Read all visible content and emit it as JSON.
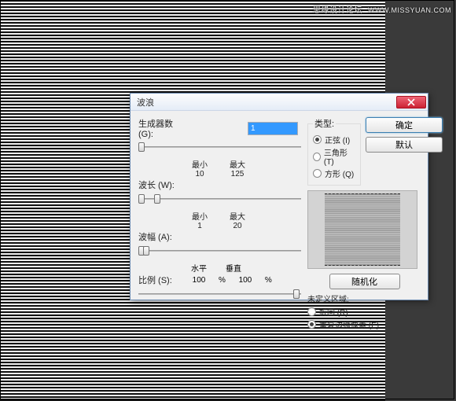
{
  "watermark": {
    "cn": "思缘设计论坛",
    "en": "WWW.MISSYUAN.COM"
  },
  "dialog": {
    "title": "波浪",
    "generators": {
      "label": "生成器数 (G):",
      "value": "1"
    },
    "wavelength": {
      "label": "波长 (W):",
      "min_label": "最小",
      "max_label": "最大",
      "min": "10",
      "max": "125"
    },
    "amplitude": {
      "label": "波幅 (A):",
      "min_label": "最小",
      "max_label": "最大",
      "min": "1",
      "max": "20"
    },
    "scale": {
      "label": "比例 (S):",
      "h_label": "水平",
      "v_label": "垂直",
      "h": "100",
      "v": "100",
      "unit": "%"
    },
    "type": {
      "legend": "类型:",
      "sine": "正弦 (I)",
      "triangle": "三角形 (T)",
      "square": "方形 (Q)",
      "selected": "sine"
    },
    "buttons": {
      "ok": "确定",
      "default": "默认",
      "randomize": "随机化"
    },
    "undefined_area": {
      "legend": "未定义区域:",
      "wrap": "折回 (R)",
      "repeat": "重复边缘像素 (E)",
      "selected": "repeat"
    }
  }
}
